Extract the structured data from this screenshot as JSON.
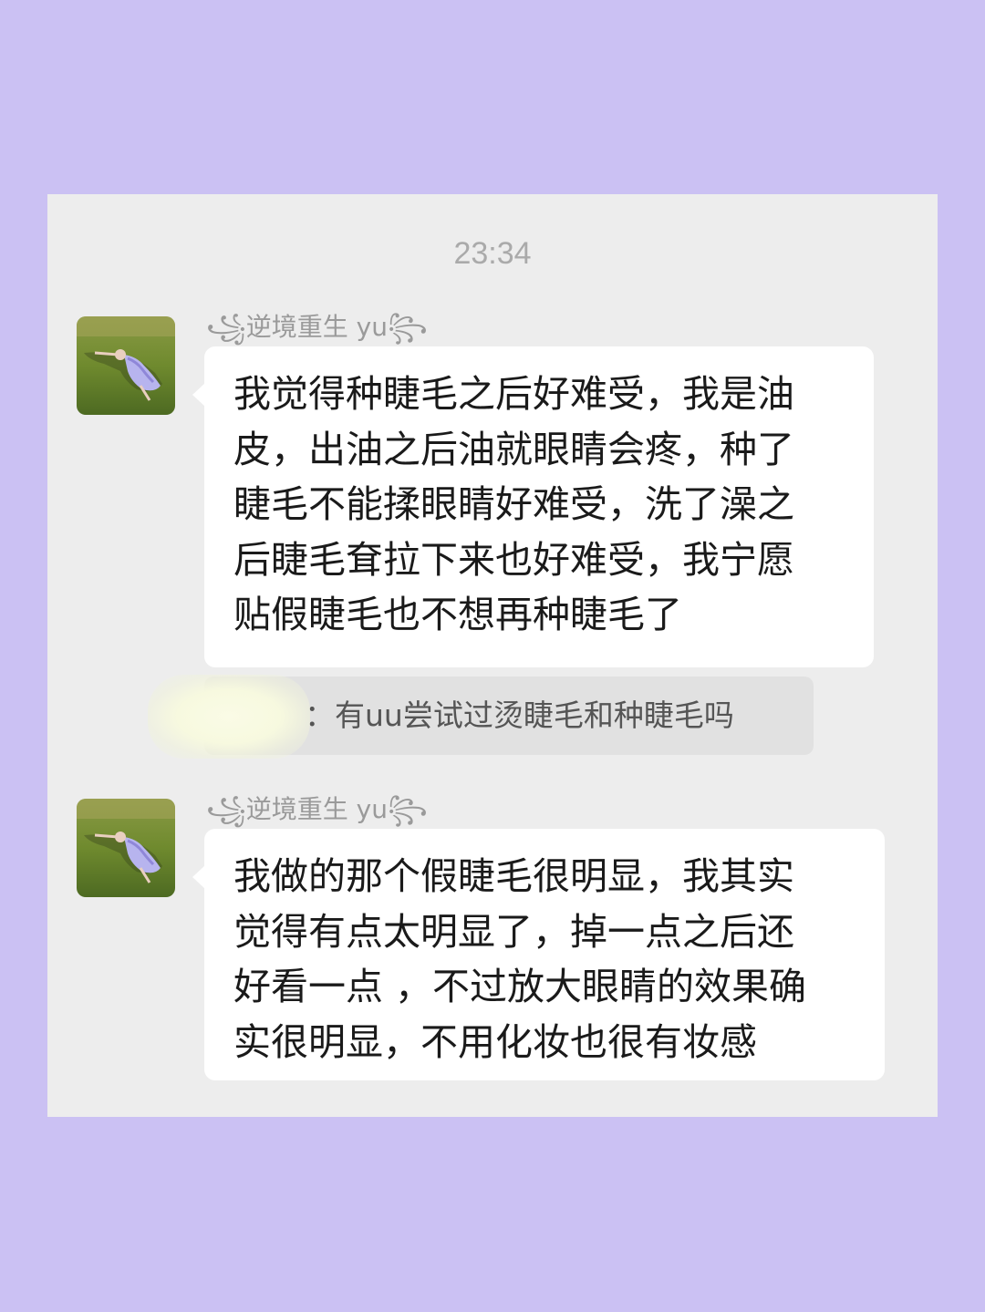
{
  "chat": {
    "timestamp": "23:34",
    "messages": [
      {
        "sender": "꧁逆境重生 yu꧂",
        "lines": [
          "我觉得种睫毛之后好难受，我是油",
          "皮，出油之后油就眼睛会疼，种了",
          "睫毛不能揉眼睛好难受，洗了澡之",
          "后睫毛耷拉下来也好难受，我宁愿",
          "贴假睫毛也不想再种睫毛了"
        ]
      },
      {
        "sender": "꧁逆境重生 yu꧂",
        "lines": [
          "我做的那个假睫毛很明显，我其实",
          "觉得有点太明显了，掉一点之后还",
          "好看一点 ，不过放大眼睛的效果确",
          "实很明显，不用化妆也很有妆感"
        ]
      }
    ],
    "quote": {
      "text": "：有uu尝试过烫睫毛和种睫毛吗"
    }
  },
  "colors": {
    "page_background": "#cbc1f3",
    "chat_background": "#ededed",
    "bubble": "#ffffff",
    "quote_background": "#e1e1e1"
  }
}
